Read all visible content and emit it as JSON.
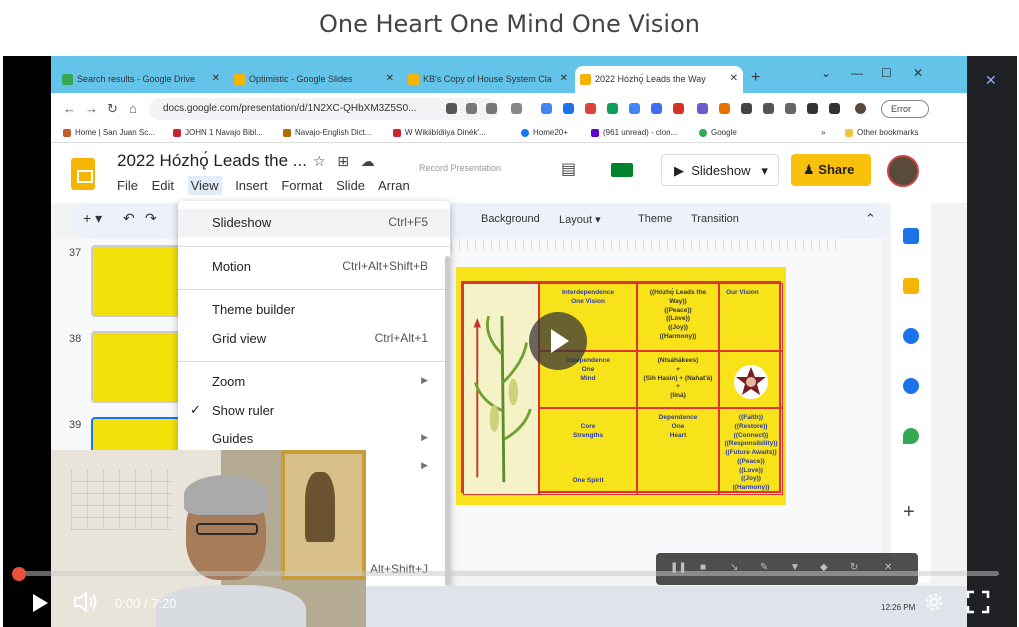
{
  "page": {
    "title": "One Heart One Mind One Vision"
  },
  "browser": {
    "tabs": [
      {
        "label": "Search results - Google Drive",
        "color": "#34a853"
      },
      {
        "label": "Optimistic - Google Slides",
        "color": "#f4b400"
      },
      {
        "label": "KB's Copy of House System Cla",
        "color": "#f4b400"
      },
      {
        "label": "2022 Hózhǫ́ Leads the Way",
        "color": "#f4b400"
      }
    ],
    "url": "docs.google.com/presentation/d/1N2XC-QHbXM3Z5S0...",
    "error_label": "Error",
    "bookmarks": [
      {
        "label": "Home | San Juan Sc...",
        "color": "#c35b2c"
      },
      {
        "label": "JOHN 1 Navajo Bibl...",
        "color": "#c6262e"
      },
      {
        "label": "Navajo-English Dict...",
        "color": "#b36b00"
      },
      {
        "label": "W  Wikiibídiiya Dinék'...",
        "color": "#555555"
      },
      {
        "label": "Home20+",
        "color": "#1877f2"
      },
      {
        "label": "(961 unread) - clon...",
        "color": "#6001d2"
      },
      {
        "label": "Google",
        "color": "#34a853"
      }
    ],
    "other_bookmarks": "Other bookmarks"
  },
  "slides": {
    "doc_title": "2022 Hózhǫ́ Leads the ...",
    "menus": [
      "File",
      "Edit",
      "View",
      "Insert",
      "Format",
      "Slide",
      "Arran"
    ],
    "record_label": "Record Presentation",
    "slideshow_label": "Slideshow",
    "share_label": "Share",
    "toolbar": [
      "Background",
      "Layout ▾",
      "Theme",
      "Transition"
    ],
    "filmstrip_numbers": [
      "37",
      "38",
      "39"
    ]
  },
  "view_menu": {
    "items": [
      {
        "label": "Slideshow",
        "shortcut": "Ctrl+F5"
      },
      {
        "label": "Motion",
        "shortcut": "Ctrl+Alt+Shift+B"
      },
      {
        "label": "Theme builder",
        "shortcut": ""
      },
      {
        "label": "Grid view",
        "shortcut": "Ctrl+Alt+1"
      },
      {
        "label": "Zoom",
        "shortcut": ""
      },
      {
        "label": "Show ruler",
        "shortcut": ""
      },
      {
        "label": "Guides",
        "shortcut": ""
      }
    ],
    "extra_shortcut": "Alt+Shift+J"
  },
  "slide_content": {
    "r1c1": "Interdependence\nOne Vision",
    "r1c2": "((Hózhǫ́ Leads the\nWay))\n((Peace))\n((Love))\n((Joy))\n((Harmony))",
    "r1c4": "Our Vision",
    "r2c1": "Independence\nOne\nMind",
    "r2c2": "(Ntsáhákees)\n+\n(Sih Hasin) + (Nahat'á)\n+\n(Iiná)",
    "r3c1": "Dependence\nOne\nHeart",
    "r3c2": "((Faith))\n((Restore))\n((Connect))\n((Responsibility))\n((Future Awaits))\n((Peace))\n((Love))\n((Joy))\n((Harmony))",
    "r3c4a": "Core\nStrengths",
    "r3c4b": "One Spirit"
  },
  "player": {
    "current_time": "0:00",
    "separator": " / ",
    "duration": "7:20",
    "progress_fraction": 0.0,
    "accent": "#e8503a"
  },
  "taskbar": {
    "clock": "12:26 PM"
  }
}
